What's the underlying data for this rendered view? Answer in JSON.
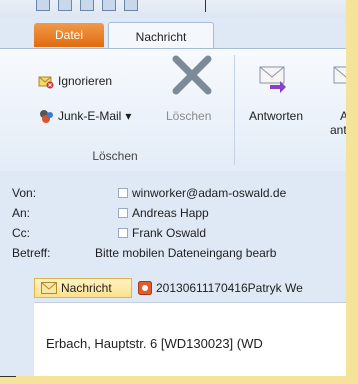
{
  "tabs": {
    "file": "Datei",
    "message": "Nachricht"
  },
  "ribbon": {
    "ignore": "Ignorieren",
    "junk": "Junk-E-Mail",
    "junk_arrow": "▾",
    "delete": "Löschen",
    "group_delete": "Löschen",
    "reply": "Antworten",
    "reply_all_1": "A",
    "reply_all_2": "antw"
  },
  "header": {
    "from_label": "Von:",
    "from_value": "winworker@adam-oswald.de",
    "to_label": "An:",
    "to_value": "Andreas Happ",
    "cc_label": "Cc:",
    "cc_value": "Frank Oswald",
    "subject_label": "Betreff:",
    "subject_value": "Bitte mobilen Dateneingang bearb"
  },
  "attachments": {
    "message_tab": "Nachricht",
    "file_tab": "20130611170416Patryk We"
  },
  "body": {
    "text": "Erbach, Hauptstr. 6 [WD130023] (WD"
  },
  "colors": {
    "file_tab": "#e06b12",
    "ribbon_bg": "#e3ecf7",
    "window_bg": "#dfe9f5",
    "backdrop": "#f6e39a"
  }
}
